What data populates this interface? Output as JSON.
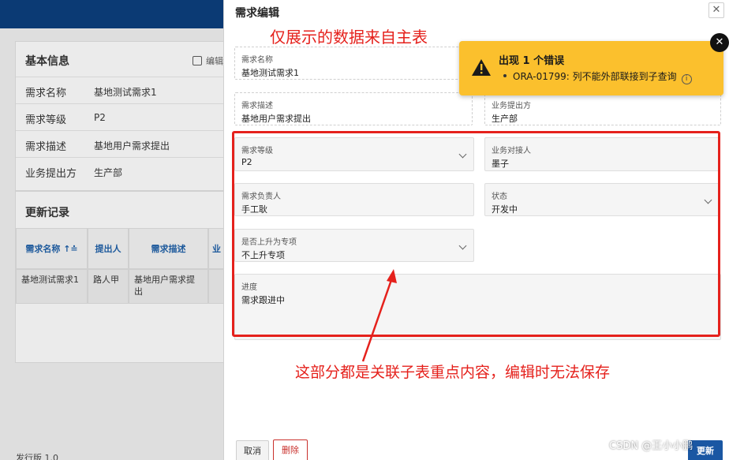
{
  "background": {
    "basic_info": {
      "title": "基本信息",
      "edit_label": "编辑",
      "rows": [
        {
          "key": "需求名称",
          "value": "基地测试需求1"
        },
        {
          "key": "需求等级",
          "value": "P2"
        },
        {
          "key": "需求描述",
          "value": "基地用户需求提出"
        },
        {
          "key": "业务提出方",
          "value": "生产部"
        }
      ]
    },
    "history": {
      "title": "更新记录",
      "headers": [
        "需求名称 ↑≐",
        "提出人",
        "需求描述",
        "业"
      ],
      "row": [
        "基地测试需求1",
        "路人甲",
        "基地用户需求提出"
      ]
    },
    "footer": "发行版 1.0"
  },
  "drawer": {
    "title": "需求编辑",
    "close": "✕",
    "fields": {
      "name": {
        "label": "需求名称",
        "value": "基地测试需求1"
      },
      "desc": {
        "label": "需求描述",
        "value": "基地用户需求提出"
      },
      "proposer": {
        "label": "业务提出方",
        "value": "生产部"
      },
      "level": {
        "label": "需求等级",
        "value": "P2"
      },
      "contact": {
        "label": "业务对接人",
        "value": "墨子"
      },
      "owner": {
        "label": "需求负责人",
        "value": "手工耿"
      },
      "status": {
        "label": "状态",
        "value": "开发中"
      },
      "upgrade": {
        "label": "是否上升为专项",
        "value": "不上升专项"
      },
      "progress": {
        "label": "进度",
        "value": "需求跟进中"
      }
    },
    "buttons": {
      "cancel": "取消",
      "delete": "删除",
      "save": "更新"
    }
  },
  "annotations": {
    "top": "仅展示的数据来自主表",
    "bottom": "这部分都是关联子表重点内容，编辑时无法保存"
  },
  "toast": {
    "title": "出现 1 个错误",
    "message": "ORA-01799: 列不能外部联接到子查询",
    "close": "✕"
  },
  "watermark": "CSDN @王小小鹏",
  "colors": {
    "accent_red": "#e5211c",
    "toast_bg": "#fbc02d",
    "brand_blue": "#1a57a3"
  }
}
